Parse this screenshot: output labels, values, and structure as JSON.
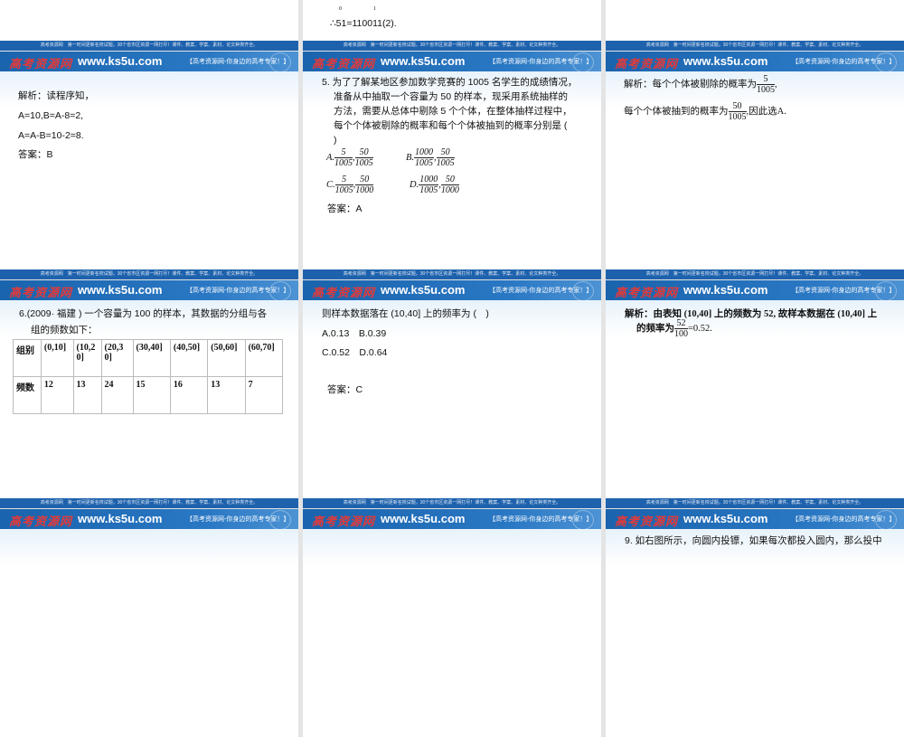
{
  "brand": {
    "logo": "高考资源网",
    "url": "www.ks5u.com",
    "slogan": "【高考资源网-你身边的高考专家！】",
    "footer": "高考资源网　第一时间更新名校试题，30个省市区资源一网打尽！课件、教案、学案、素材、论文种类齐全。"
  },
  "slides": {
    "s0b": {
      "sub": "0",
      "sub2": "1",
      "line": "∴51=110011(2)."
    },
    "s1": {
      "l1": "解析：读程序知，",
      "l2": "A=10,B=A-8=2,",
      "l3": "A=A-B=10-2=8.",
      "l4": "答案：B"
    },
    "s2": {
      "q1": "5. 为了了解某地区参加数学竞赛的 1005 名学生的成绩情况，",
      "q2": "准备从中抽取一个容量为 50 的样本，现采用系统抽样的",
      "q3": "方法，需要从总体中剔除 5 个个体，在整体抽样过程中，",
      "q4": "每个个体被剔除的概率和每个个体被抽到的概率分别是 (",
      "q5": ")",
      "options": [
        {
          "label": "A.",
          "f1": [
            "5",
            "1005"
          ],
          "f2": [
            "50",
            "1005"
          ]
        },
        {
          "label": "B.",
          "f1": [
            "1000",
            "1005"
          ],
          "f2": [
            "50",
            "1005"
          ]
        },
        {
          "label": "C.",
          "f1": [
            "5",
            "1005"
          ],
          "f2": [
            "50",
            "1000"
          ]
        },
        {
          "label": "D.",
          "f1": [
            "1000",
            "1005"
          ],
          "f2": [
            "50",
            "1000"
          ]
        }
      ],
      "answer": "答案：A"
    },
    "s3": {
      "l1": "解析：每个个体被剔除的概率为",
      "f1": [
        "5",
        "1005"
      ],
      "c1": ",",
      "l2": "每个个体被抽到的概率为",
      "f2": [
        "50",
        "1005"
      ],
      "c2": ",因此选A."
    },
    "s4": {
      "q1": "6.(2009· 福建 ) 一个容量为 100 的样本，其数据的分组与各",
      "q2": "组的频数如下：",
      "headers": [
        "组别",
        "(0,10]",
        "(10,20]",
        "(20,30]",
        "(30,40]",
        "(40,50]",
        "(50,60]",
        "(60,70]"
      ],
      "row": [
        "频数",
        "12",
        "13",
        "24",
        "15",
        "16",
        "13",
        "7"
      ]
    },
    "s5": {
      "q": "则样本数据落在 (10,40] 上的频率为 (　)",
      "o1": "A.0.13　B.0.39",
      "o2": "C.0.52　D.0.64",
      "answer": "答案：C"
    },
    "s6": {
      "l1": "解析：由表知 (10,40] 上的频数为 52, 故样本数据在 (10,40] 上",
      "l2": "的频率为",
      "f": [
        "52",
        "100"
      ],
      "l3": "=0.52."
    },
    "s9": {
      "l1": "9. 如右图所示，向圆内投镖，如果每次都投入圆内，那么投中"
    }
  }
}
